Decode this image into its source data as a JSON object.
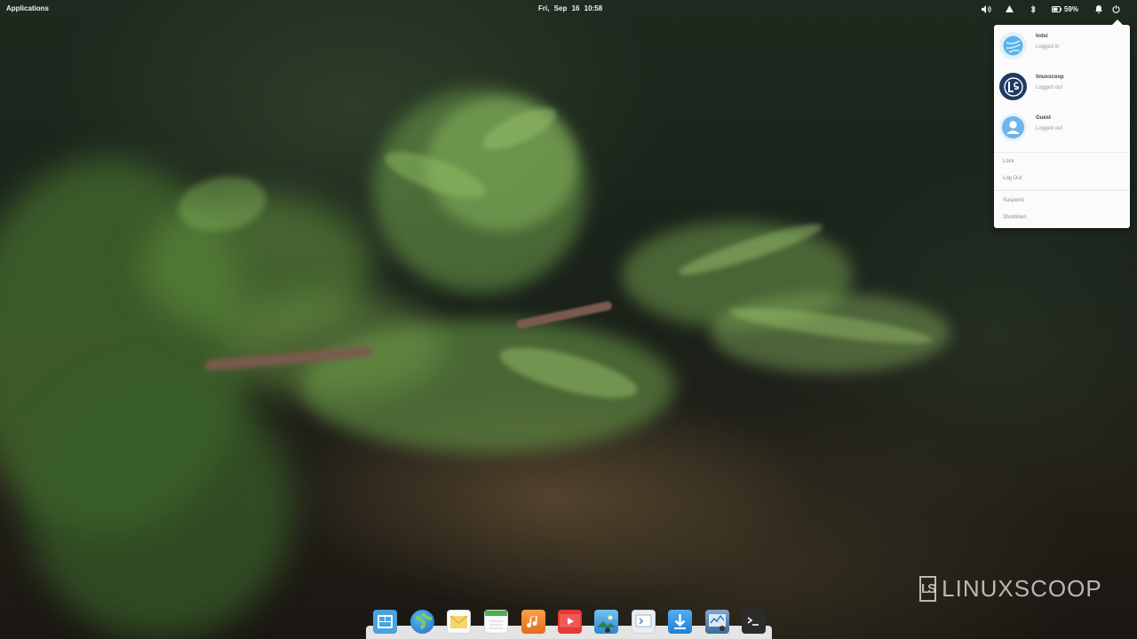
{
  "panel": {
    "applications_label": "Applications",
    "clock": "Fri, Sep 16   10:58",
    "battery": "59%",
    "icons": [
      "volume-icon",
      "network-icon",
      "bluetooth-icon",
      "battery-icon",
      "notifications-icon",
      "power-icon"
    ]
  },
  "session_menu": {
    "users": [
      {
        "name": "Ivdsi",
        "status": "Logged in",
        "avatar_icon": "user-globe-avatar",
        "avatar_color": "#5ab3e8"
      },
      {
        "name": "linuxscoop",
        "status": "Logged out",
        "avatar_icon": "linuxscoop-logo-avatar",
        "avatar_color": "#1f3b63"
      },
      {
        "name": "Guest",
        "status": "Logged out",
        "avatar_icon": "guest-avatar",
        "avatar_color": "#6fb3ea"
      }
    ],
    "items": [
      "Lock",
      "Log Out",
      "Suspend",
      "Shutdown"
    ]
  },
  "watermark": {
    "logo": "LS",
    "text": "LINUXSCOOP"
  },
  "dock": {
    "apps": [
      {
        "name": "multitasking-view-icon",
        "color": "#4aa3df"
      },
      {
        "name": "web-browser-icon",
        "color": "#2f8fd8"
      },
      {
        "name": "mail-icon",
        "color": "#f7d56a"
      },
      {
        "name": "calendar-icon",
        "color": "#4caf50"
      },
      {
        "name": "music-icon",
        "color": "#f08a2e"
      },
      {
        "name": "videos-icon",
        "color": "#e53935"
      },
      {
        "name": "photos-icon",
        "color": "#3b8ed8"
      },
      {
        "name": "switchboard-icon",
        "color": "#e8eef4"
      },
      {
        "name": "appcenter-icon",
        "color": "#2f93e0"
      },
      {
        "name": "system-monitor-icon",
        "color": "#4f79a8"
      },
      {
        "name": "terminal-icon",
        "color": "#2b2b2b"
      }
    ]
  }
}
